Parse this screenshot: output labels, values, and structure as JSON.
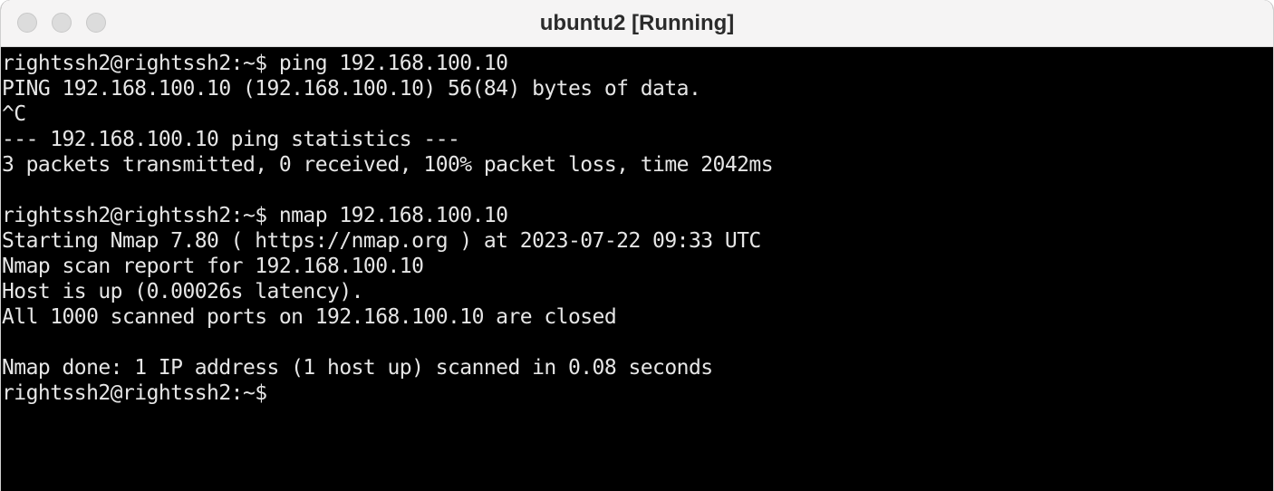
{
  "window": {
    "title": "ubuntu2 [Running]",
    "traffic_lights": [
      "close-button",
      "minimize-button",
      "maximize-button"
    ]
  },
  "terminal": {
    "lines": [
      "rightssh2@rightssh2:~$ ping 192.168.100.10",
      "PING 192.168.100.10 (192.168.100.10) 56(84) bytes of data.",
      "^C",
      "--- 192.168.100.10 ping statistics ---",
      "3 packets transmitted, 0 received, 100% packet loss, time 2042ms",
      "",
      "rightssh2@rightssh2:~$ nmap 192.168.100.10",
      "Starting Nmap 7.80 ( https://nmap.org ) at 2023-07-22 09:33 UTC",
      "Nmap scan report for 192.168.100.10",
      "Host is up (0.00026s latency).",
      "All 1000 scanned ports on 192.168.100.10 are closed",
      "",
      "Nmap done: 1 IP address (1 host up) scanned in 0.08 seconds",
      "rightssh2@rightssh2:~$"
    ]
  }
}
